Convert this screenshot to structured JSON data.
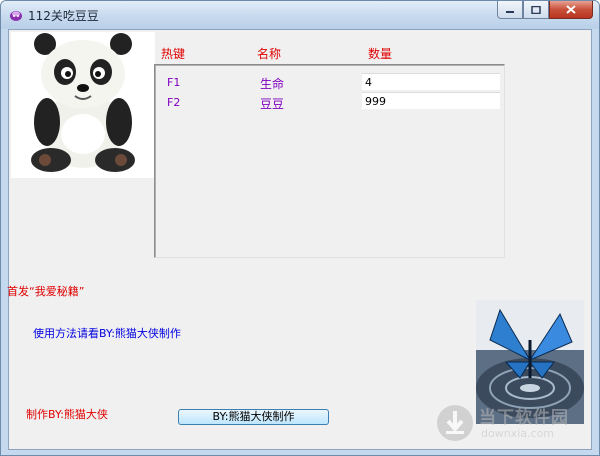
{
  "window": {
    "title": "112关吃豆豆"
  },
  "table": {
    "headers": [
      "热键",
      "名称",
      "数量"
    ],
    "rows": [
      {
        "hotkey": "F1",
        "name": "生命",
        "value": "4"
      },
      {
        "hotkey": "F2",
        "name": "豆豆",
        "value": "999"
      }
    ]
  },
  "labels": {
    "first_release": "首发“我爱秘籍”",
    "usage": "使用方法请看BY:熊猫大侠制作",
    "made_by": "制作BY:熊猫大侠"
  },
  "button": {
    "label": "BY:熊猫大侠制作"
  },
  "watermark": {
    "brand": "当下软件园",
    "sub": "downxia.com"
  },
  "colors": {
    "header_red": "#e00000",
    "hotkey_purple": "#8000c0",
    "usage_blue": "#0000e0"
  }
}
